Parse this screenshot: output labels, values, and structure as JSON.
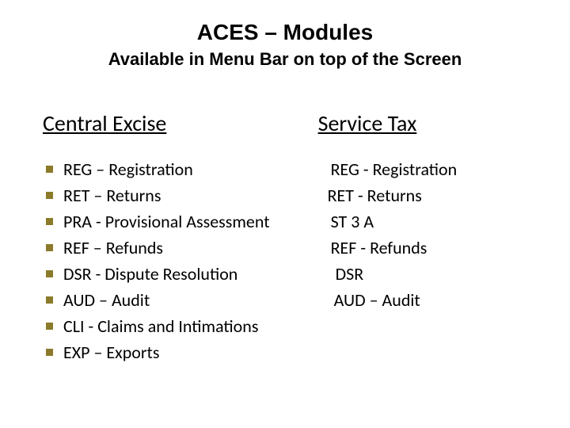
{
  "title": "ACES – Modules",
  "subtitle": "Available in Menu Bar on top of the Screen",
  "left": {
    "heading": "Central Excise",
    "items": [
      "REG – Registration",
      "RET – Returns",
      "PRA - Provisional Assessment",
      "REF – Refunds",
      "DSR - Dispute Resolution",
      "AUD – Audit",
      "CLI   - Claims and Intimations",
      "EXP – Exports"
    ]
  },
  "right": {
    "heading": "Service Tax",
    "items": [
      "REG - Registration",
      "RET - Returns",
      "ST 3 A",
      "REF - Refunds",
      "DSR",
      "AUD – Audit"
    ]
  }
}
